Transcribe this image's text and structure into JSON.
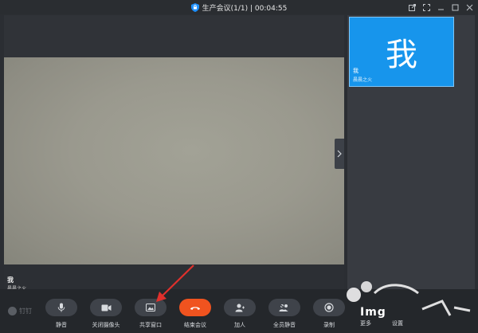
{
  "window": {
    "title": "生产会议(1/1) | 00:04:55",
    "controls": [
      "share-out-icon",
      "fullscreen-icon",
      "minimize-icon",
      "maximize-icon",
      "close-icon"
    ]
  },
  "main_video": {
    "name": "我",
    "subtitle": "晨晨之火"
  },
  "side_panel": {
    "tile": {
      "avatar_text": "我",
      "name": "我",
      "subtitle": "晨晨之火",
      "color": "#1795ec"
    }
  },
  "toolbar": {
    "logo": "钉钉",
    "buttons": [
      {
        "label": "静音",
        "icon": "microphone-icon"
      },
      {
        "label": "关闭摄像头",
        "icon": "camera-icon"
      },
      {
        "label": "共享窗口",
        "icon": "screen-share-icon"
      },
      {
        "label": "结束会议",
        "icon": "hang-up-icon",
        "color": "#f0531f"
      },
      {
        "label": "加人",
        "icon": "add-person-icon"
      },
      {
        "label": "全员静音",
        "icon": "mute-all-icon"
      },
      {
        "label": "录制",
        "icon": "record-icon"
      }
    ],
    "partial_labels": [
      "更多",
      "设置"
    ]
  },
  "watermark": {
    "text": "Img"
  }
}
